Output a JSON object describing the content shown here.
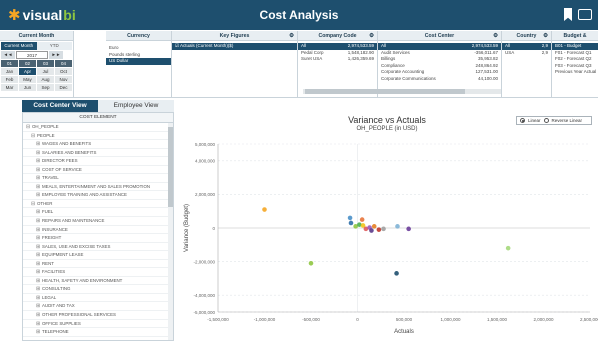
{
  "app": {
    "title": "Cost Analysis",
    "logo_text": "visual",
    "logo_suffix": "bi"
  },
  "icons": {
    "bookmark": "bookmark-icon",
    "print": "print-icon"
  },
  "colors": {
    "header": "#1e4f6e",
    "accent": "#8fc641",
    "logo_star": "#f5a623"
  },
  "filters": {
    "current_month": {
      "header": "Current Month",
      "toggle_month": "Current Month",
      "toggle_ytd": "YTD",
      "prev": "◄◄",
      "year": "2017",
      "next": "►►",
      "quarters": [
        "01",
        "02",
        "03",
        "04"
      ],
      "months": [
        [
          "Jan",
          "Apr",
          "Jul",
          "Oct"
        ],
        [
          "Feb",
          "May",
          "Aug",
          "Nov"
        ],
        [
          "Mar",
          "Jun",
          "Sep",
          "Dec"
        ]
      ],
      "selected_month": "Apr"
    },
    "currency": {
      "header": "Currency",
      "items": [
        "Euro",
        "Pounds sterling",
        "US Dollar"
      ],
      "selected": "US Dollar"
    },
    "key_figures": {
      "header": "Key Figures",
      "items": [
        "Actuals (Current Month)($)"
      ]
    },
    "company_code": {
      "header": "Company Code",
      "rows": [
        {
          "label": "All",
          "value": "2,974,533.59"
        },
        {
          "label": "Pedal Corp",
          "value": "1,548,182.90"
        },
        {
          "label": "Suret USA",
          "value": "1,426,359.69"
        }
      ]
    },
    "cost_center": {
      "header": "Cost Center",
      "rows": [
        {
          "label": "All",
          "value": "2,974,533.59"
        },
        {
          "label": "Audit Services",
          "value": "-356,011.67"
        },
        {
          "label": "Billings",
          "value": "35,953.82"
        },
        {
          "label": "Compliance",
          "value": "248,864.92"
        },
        {
          "label": "Corporate Accounting",
          "value": "127,531.00"
        },
        {
          "label": "Corporate Communications",
          "value": "44,100.00"
        }
      ]
    },
    "country": {
      "header": "Country",
      "rows": [
        {
          "label": "All",
          "value": "2,9"
        },
        {
          "label": "USA",
          "value": "2,9"
        }
      ]
    },
    "budget_forecast": {
      "header": "Budget & Forecast",
      "items": [
        "B01 - Budget",
        "F01 - Forecast Q1",
        "F02 - Forecast Q2",
        "F03 - Forecast Q3",
        "Previous Year Actual"
      ],
      "selected": "B01 - Budget"
    }
  },
  "tabs": [
    {
      "label": "Cost Center View",
      "active": true
    },
    {
      "label": "Employee View",
      "active": false
    }
  ],
  "tree": {
    "header": "COST ELEMENT",
    "rows": [
      {
        "label": "OH_PEOPLE",
        "indent": 0,
        "icon": "minus"
      },
      {
        "label": "PEOPLE",
        "indent": 1,
        "icon": "minus"
      },
      {
        "label": "WAGES AND BENEFITS",
        "indent": 2,
        "icon": "plus"
      },
      {
        "label": "SALARIES AND BENEFITS",
        "indent": 2,
        "icon": "plus"
      },
      {
        "label": "DIRECTOR FEES",
        "indent": 2,
        "icon": "plus"
      },
      {
        "label": "COST OF SERVICE",
        "indent": 2,
        "icon": "plus"
      },
      {
        "label": "TRAVEL",
        "indent": 2,
        "icon": "plus"
      },
      {
        "label": "MEALS, ENTERTAINMENT AND SALES PROMOTION",
        "indent": 2,
        "icon": "plus"
      },
      {
        "label": "EMPLOYEE TRAINING AND ASSISTANCE",
        "indent": 2,
        "icon": "plus"
      },
      {
        "label": "OTHER",
        "indent": 1,
        "icon": "minus"
      },
      {
        "label": "FUEL",
        "indent": 2,
        "icon": "plus"
      },
      {
        "label": "REPAIRS AND MAINTENANCE",
        "indent": 2,
        "icon": "plus"
      },
      {
        "label": "INSURANCE",
        "indent": 2,
        "icon": "plus"
      },
      {
        "label": "FREIGHT",
        "indent": 2,
        "icon": "plus"
      },
      {
        "label": "SALES, USE AND EXCISE TAXES",
        "indent": 2,
        "icon": "plus"
      },
      {
        "label": "EQUIPMENT LEASE",
        "indent": 2,
        "icon": "plus"
      },
      {
        "label": "RENT",
        "indent": 2,
        "icon": "plus"
      },
      {
        "label": "FACILITIES",
        "indent": 2,
        "icon": "plus"
      },
      {
        "label": "HEALTH, SAFETY AND ENVIRONMENT",
        "indent": 2,
        "icon": "plus"
      },
      {
        "label": "CONSULTING",
        "indent": 2,
        "icon": "plus"
      },
      {
        "label": "LEGAL",
        "indent": 2,
        "icon": "plus"
      },
      {
        "label": "AUDIT AND TAX",
        "indent": 2,
        "icon": "plus"
      },
      {
        "label": "OTHER PROFESSIONAL SERVICES",
        "indent": 2,
        "icon": "plus"
      },
      {
        "label": "OFFICE SUPPLIES",
        "indent": 2,
        "icon": "plus"
      },
      {
        "label": "TELEPHONE",
        "indent": 2,
        "icon": "plus"
      }
    ]
  },
  "chart_toggle": {
    "option_linear": "Linear",
    "option_reverse": "Reverse Linear",
    "selected": "Linear"
  },
  "chart_data": {
    "type": "scatter",
    "title": "Variance vs Actuals",
    "subtitle": "OH_PEOPLE (in USD)",
    "xlabel": "Actuals",
    "ylabel": "Variance (Budget)",
    "xlim": [
      -1500000,
      2500000
    ],
    "ylim": [
      -5000000,
      5000000
    ],
    "xticks": [
      -1500000,
      -1000000,
      -500000,
      0,
      500000,
      1000000,
      1500000,
      2000000,
      2500000
    ],
    "xtick_labels": [
      "-1,500,000",
      "-1,000,000",
      "-500,000",
      "0",
      "500,000",
      "1,000,000",
      "1,500,000",
      "2,000,000",
      "2,500,000"
    ],
    "yticks": [
      -5000000,
      -4000000,
      -2000000,
      0,
      2000000,
      4000000,
      5000000
    ],
    "ytick_labels": [
      "-5,000,000",
      "-4,000,000",
      "-2,000,000",
      "0",
      "2,000,000",
      "4,000,000",
      "5,000,000"
    ],
    "grid": true,
    "points": [
      {
        "x": -1000000,
        "y": 1100000,
        "color": "#f5a623"
      },
      {
        "x": -80000,
        "y": 600000,
        "color": "#4a90c8"
      },
      {
        "x": -70000,
        "y": 300000,
        "color": "#2c6fa8"
      },
      {
        "x": 50000,
        "y": 500000,
        "color": "#e8743b"
      },
      {
        "x": -20000,
        "y": 100000,
        "color": "#8fc641"
      },
      {
        "x": 20000,
        "y": 200000,
        "color": "#4caf50"
      },
      {
        "x": 60000,
        "y": 150000,
        "color": "#f0c419"
      },
      {
        "x": 90000,
        "y": -50000,
        "color": "#e05c5c"
      },
      {
        "x": 130000,
        "y": 30000,
        "color": "#9b59b6"
      },
      {
        "x": 150000,
        "y": -150000,
        "color": "#5b3a8a"
      },
      {
        "x": 180000,
        "y": 100000,
        "color": "#e67e22"
      },
      {
        "x": 230000,
        "y": -100000,
        "color": "#c0392b"
      },
      {
        "x": 280000,
        "y": -50000,
        "color": "#a0a0a0"
      },
      {
        "x": -500000,
        "y": -2100000,
        "color": "#8fc641"
      },
      {
        "x": 420000,
        "y": -2700000,
        "color": "#1e4f6e"
      },
      {
        "x": 430000,
        "y": 100000,
        "color": "#7fb3d5"
      },
      {
        "x": 550000,
        "y": -50000,
        "color": "#6a3d9a"
      },
      {
        "x": 1620000,
        "y": -1200000,
        "color": "#a5d87b"
      }
    ]
  }
}
